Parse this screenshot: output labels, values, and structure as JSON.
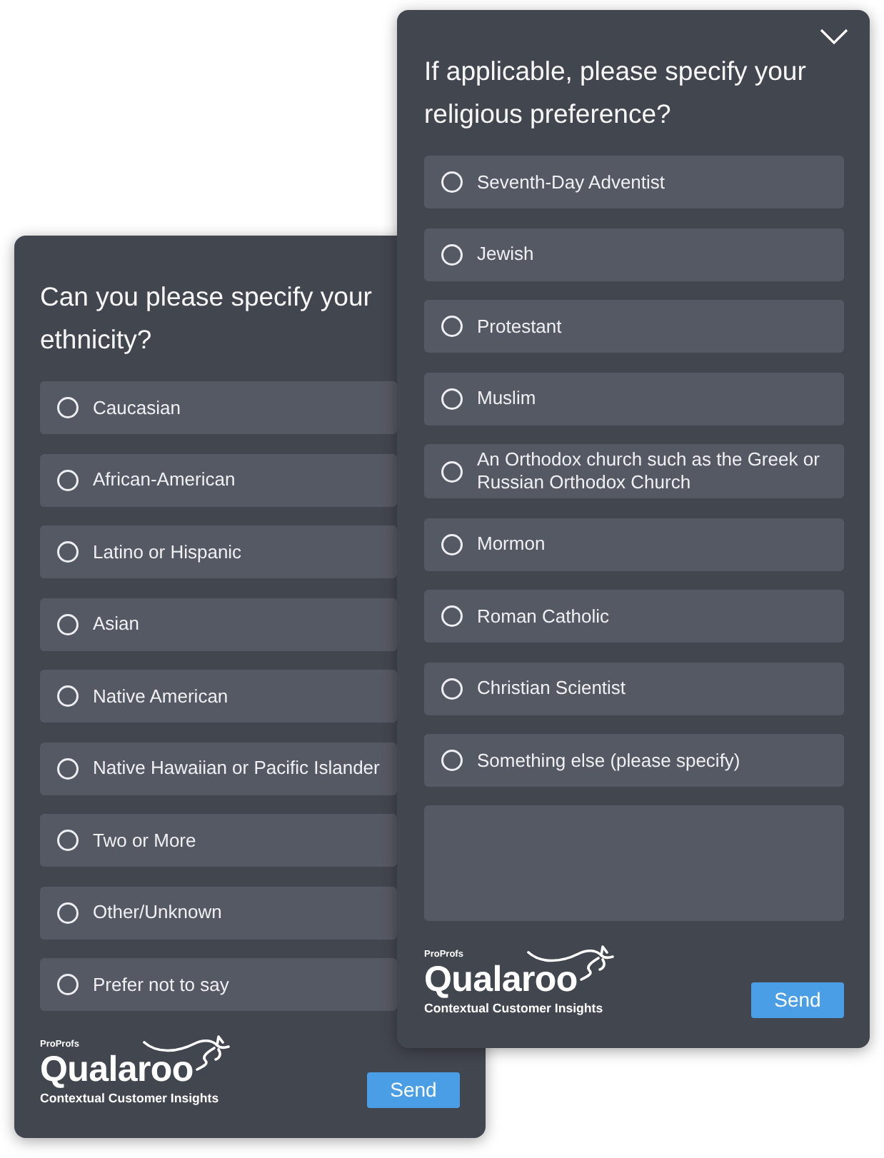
{
  "surveys": [
    {
      "question": "Can you please specify your ethnicity?",
      "collapse_button": false,
      "options": [
        {
          "label": "Caucasian",
          "selected": false
        },
        {
          "label": "African-American",
          "selected": false
        },
        {
          "label": "Latino or Hispanic",
          "selected": false
        },
        {
          "label": "Asian",
          "selected": false
        },
        {
          "label": "Native American",
          "selected": false
        },
        {
          "label": "Native Hawaiian or Pacific Islander",
          "selected": false
        },
        {
          "label": "Two or More",
          "selected": false
        },
        {
          "label": "Other/Unknown",
          "selected": false
        },
        {
          "label": "Prefer not to say",
          "selected": false
        }
      ],
      "comment_box": false,
      "brand": {
        "company": "ProProfs",
        "product": "Qualaroo",
        "tagline": "Contextual Customer Insights"
      },
      "send_button": "Send"
    },
    {
      "question": "If applicable, please specify your religious preference?",
      "collapse_button": true,
      "options": [
        {
          "label": "Seventh-Day Adventist",
          "selected": false
        },
        {
          "label": "Jewish",
          "selected": false
        },
        {
          "label": "Protestant",
          "selected": false
        },
        {
          "label": "Muslim",
          "selected": false
        },
        {
          "label": "An Orthodox church such as the Greek or Russian Orthodox Church",
          "selected": false
        },
        {
          "label": "Mormon",
          "selected": false
        },
        {
          "label": "Roman Catholic",
          "selected": false
        },
        {
          "label": "Christian Scientist",
          "selected": false
        },
        {
          "label": "Something else (please specify)",
          "selected": false
        }
      ],
      "comment_box": true,
      "brand": {
        "company": "ProProfs",
        "product": "Qualaroo",
        "tagline": "Contextual Customer Insights"
      },
      "send_button": "Send"
    }
  ]
}
